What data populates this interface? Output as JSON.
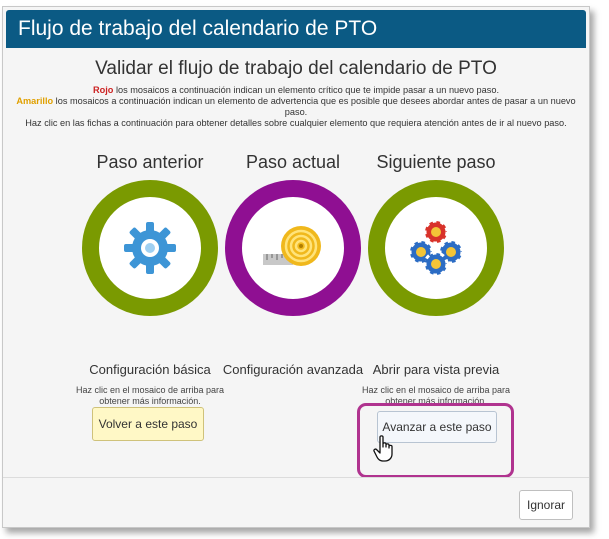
{
  "dialog": {
    "title": "Flujo de trabajo del calendario de PTO",
    "heading": "Validar el flujo de trabajo del calendario de PTO",
    "info": {
      "red_word": "Rojo",
      "red_text": " los mosaicos a continuación indican un elemento crítico que te impide pasar a un nuevo paso.",
      "amber_word": "Amarillo",
      "amber_text": " los mosaicos a continuación indican un elemento de advertencia que es posible que desees abordar antes de pasar a un nuevo paso.",
      "click_text": "Haz clic en las fichas a continuación para obtener detalles sobre cualquier elemento que requiera atención antes de ir al nuevo paso."
    },
    "steps": {
      "previous": {
        "title": "Paso anterior",
        "icon": "gear-icon",
        "ring_color": "#7a9a01",
        "label": "Configuración básica",
        "help": "Haz clic en el mosaico de arriba para obtener más información.",
        "button": "Volver a este paso"
      },
      "current": {
        "title": "Paso actual",
        "icon": "measuring-tape-icon",
        "ring_color": "#8f0f92",
        "label": "Configuración avanzada"
      },
      "next": {
        "title": "Siguiente paso",
        "icon": "poker-chips-icon",
        "ring_color": "#7a9a01",
        "label": "Abrir para vista previa",
        "help": "Haz clic en el mosaico de arriba para obtener más información.",
        "button": "Avanzar a este paso"
      }
    },
    "footer": {
      "ignore_label": "Ignorar"
    },
    "colors": {
      "titlebar": "#0b5a84",
      "green": "#7a9a01",
      "purple": "#8f0f92",
      "highlight": "#b0338f",
      "back_button": "#fff8c6"
    }
  }
}
